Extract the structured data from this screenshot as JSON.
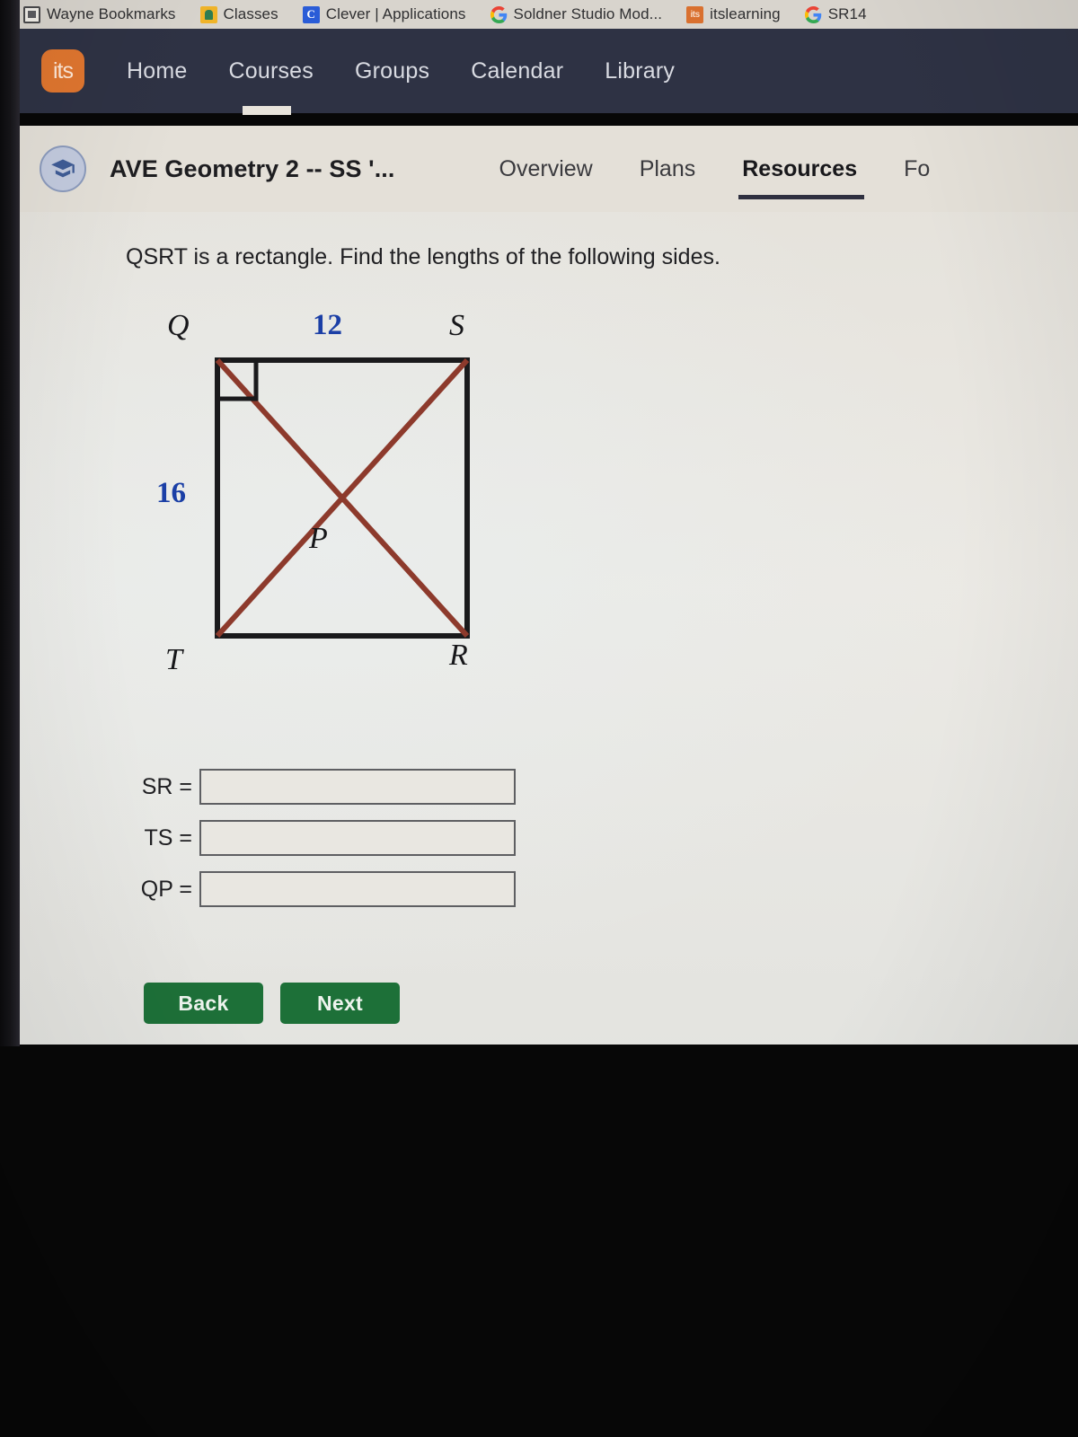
{
  "browser": {
    "bookmarks": [
      {
        "label": "Wayne Bookmarks",
        "icon": "folder-icon"
      },
      {
        "label": "Classes",
        "icon": "classes-icon"
      },
      {
        "label": "Clever | Applications",
        "icon": "clever-icon"
      },
      {
        "label": "Soldner Studio Mod...",
        "icon": "google-icon"
      },
      {
        "label": "itslearning",
        "icon": "its-icon"
      },
      {
        "label": "SR14",
        "icon": "google-icon"
      }
    ]
  },
  "topnav": {
    "logo_text": "its",
    "links": [
      "Home",
      "Courses",
      "Groups",
      "Calendar",
      "Library"
    ]
  },
  "course": {
    "title": "AVE Geometry 2 -- SS '...",
    "avatar_icon": "graduation-cap-icon",
    "tabs": [
      {
        "label": "Overview",
        "active": false
      },
      {
        "label": "Plans",
        "active": false
      },
      {
        "label": "Resources",
        "active": true
      },
      {
        "label": "Fo",
        "active": false
      }
    ]
  },
  "question": {
    "prompt": "QSRT is a rectangle. Find the lengths of the following sides."
  },
  "figure": {
    "shape": "rectangle-with-diagonals",
    "vertices": {
      "top_left": "Q",
      "top_right": "S",
      "bottom_left": "T",
      "bottom_right": "R",
      "center": "P"
    },
    "measurements": {
      "top_side": "12",
      "left_side": "16"
    },
    "right_angle_marker_at": "Q",
    "colors": {
      "outline": "#1a1a1c",
      "diagonal": "#8d3a2c",
      "measurement_text": "#1b3fa6",
      "vertex_label": "#17171a"
    }
  },
  "answers": [
    {
      "label": "SR =",
      "value": "",
      "placeholder": ""
    },
    {
      "label": "TS =",
      "value": "",
      "placeholder": ""
    },
    {
      "label": "QP =",
      "value": "",
      "placeholder": ""
    }
  ],
  "buttons": {
    "back": "Back",
    "next": "Next",
    "color": "#1d7038"
  }
}
